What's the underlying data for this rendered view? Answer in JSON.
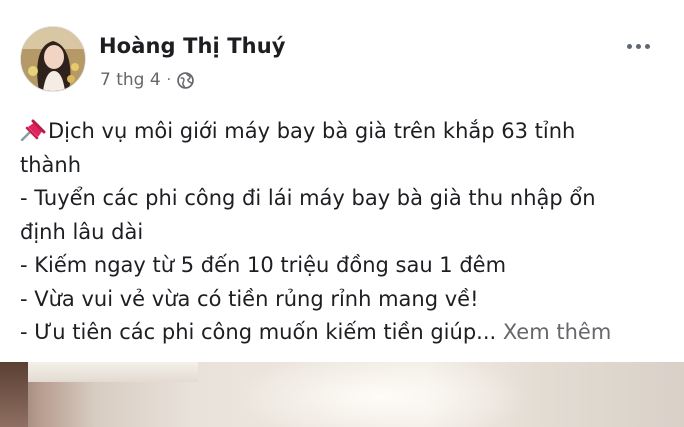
{
  "post": {
    "author": "Hoàng Thị Thuý",
    "date": "7 thg 4",
    "separator": "·",
    "privacy_icon": "globe-icon",
    "more_icon": "more-options-icon",
    "lines": [
      "Dịch vụ môi giới máy bay bà già trên khắp 63 tỉnh",
      "thành",
      "- Tuyển các phi công đi lái máy bay bà già thu nhập ổn",
      "định lâu dài",
      "- Kiếm ngay từ 5 đến 10 triệu đồng sau 1 đêm",
      "- Vừa vui vẻ vừa có tiền rủng rỉnh mang về!",
      "- Ưu tiên các phi công muốn kiếm tiền giúp..."
    ],
    "see_more": "Xem thêm",
    "pin_icon": "pushpin-icon"
  },
  "colors": {
    "text": "#1c1e21",
    "secondary": "#65676b",
    "pin": "#e0245e"
  }
}
